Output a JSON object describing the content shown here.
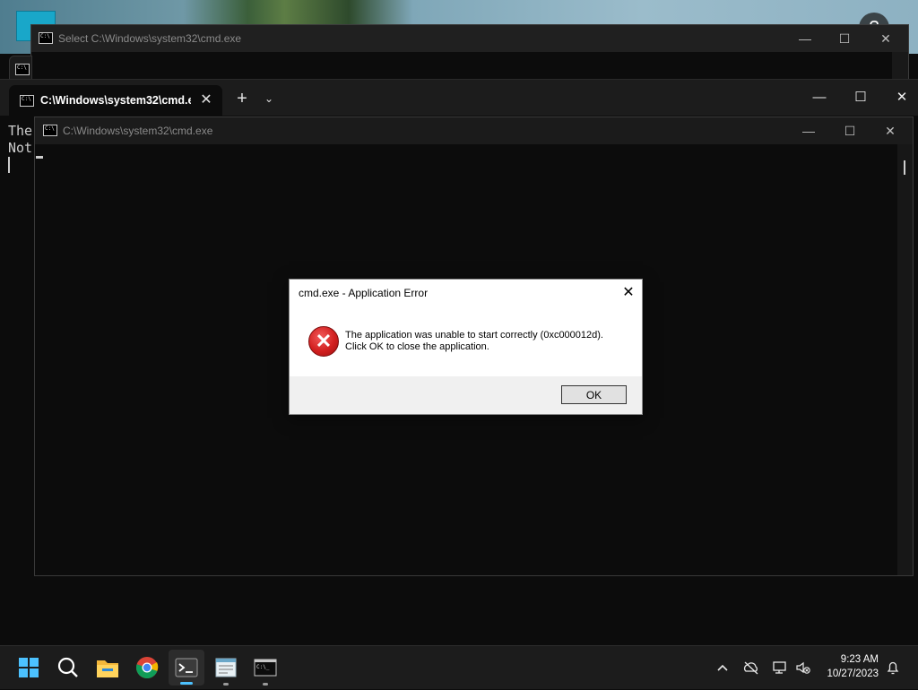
{
  "desktop": {
    "help_icon": "?"
  },
  "back_window": {
    "title": "Select C:\\Windows\\system32\\cmd.exe",
    "minimize": "—",
    "maximize": "☐",
    "close": "✕"
  },
  "terminal": {
    "tab_label": "C:\\Windows\\system32\\cmd.e:",
    "tab_close": "✕",
    "new_tab": "+",
    "dropdown": "⌄",
    "minimize": "—",
    "maximize": "☐",
    "close": "✕",
    "lines": [
      "The",
      "Not"
    ]
  },
  "cmd_window": {
    "title": "C:\\Windows\\system32\\cmd.exe",
    "minimize": "—",
    "maximize": "☐",
    "close": "✕"
  },
  "dialog": {
    "title": "cmd.exe - Application Error",
    "close": "✕",
    "message_line1": "The application was unable to start correctly (0xc000012d).",
    "message_line2": "Click OK to close the application.",
    "ok_label": "OK",
    "icon": "error-icon"
  },
  "taskbar": {
    "apps": [
      "start",
      "search",
      "file-explorer",
      "chrome",
      "terminal",
      "notepad",
      "cmd"
    ],
    "active_app": "terminal",
    "tray": {
      "time": "9:23 AM",
      "date": "10/27/2023",
      "chevron": "^",
      "notification_icon": "bell-icon"
    }
  },
  "colors": {
    "terminal_bg": "#0c0c0c",
    "accent": "#4cc2ff",
    "error_red": "#d21f1f"
  }
}
